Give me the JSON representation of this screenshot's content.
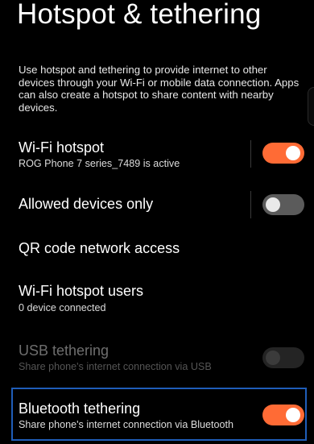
{
  "header": {
    "title": "Hotspot & tethering"
  },
  "description": "Use hotspot and tethering to provide internet to other devices through your Wi-Fi or mobile data connection. Apps can also create a hotspot to share content with nearby devices.",
  "settings": {
    "wifi_hotspot": {
      "title": "Wi-Fi hotspot",
      "subtitle": "ROG Phone 7 series_7489 is active",
      "enabled": true
    },
    "allowed_devices": {
      "title": "Allowed devices only",
      "enabled": false
    },
    "qr_code": {
      "title": "QR code network access"
    },
    "hotspot_users": {
      "title": "Wi-Fi hotspot users",
      "subtitle": "0 device connected"
    },
    "usb_tethering": {
      "title": "USB tethering",
      "subtitle": "Share phone's internet connection via USB",
      "enabled": false,
      "disabled": true
    },
    "bluetooth_tethering": {
      "title": "Bluetooth tethering",
      "subtitle": "Share phone's internet connection via Bluetooth",
      "enabled": true
    }
  },
  "colors": {
    "background": "#000000",
    "accent_toggle_on": "#ff6b35",
    "toggle_off": "#5b5b5b",
    "highlight_border": "#1f5db8"
  }
}
